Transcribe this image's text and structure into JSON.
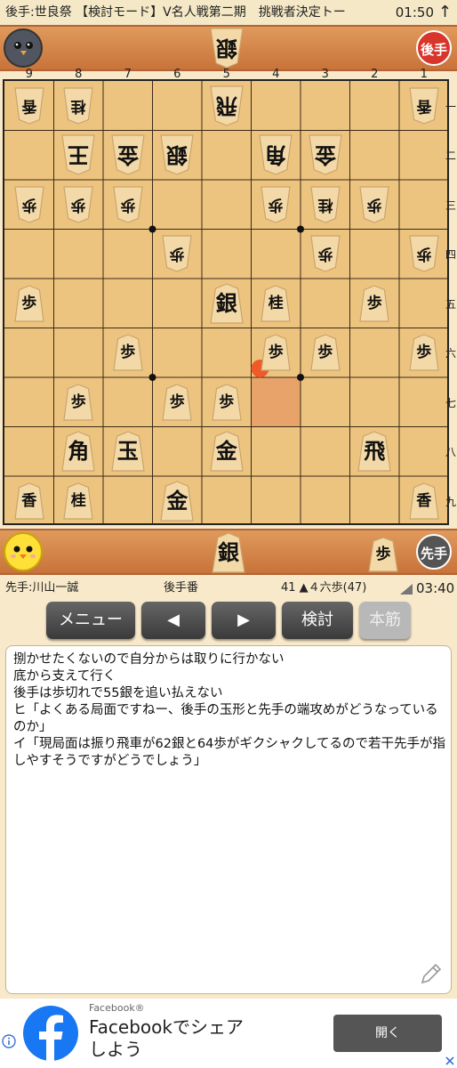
{
  "status_bar": {
    "title": "後手:世良祭 【検討モード】V名人戦第二期　挑戦者決定トー",
    "time": "01:50",
    "up_arrow": "↑"
  },
  "gote_bar": {
    "avatar_icon": "gray-bird-icon",
    "hand_pieces": [
      "銀"
    ],
    "badge": "後手",
    "badge_color": "#d9362b"
  },
  "sente_bar": {
    "avatar_icon": "yellow-chick-icon",
    "hand_pieces": [
      "銀",
      "歩"
    ],
    "badge": "先手",
    "badge_color": "#555555"
  },
  "board": {
    "files": [
      "9",
      "8",
      "7",
      "6",
      "5",
      "4",
      "3",
      "2",
      "1"
    ],
    "ranks": [
      "一",
      "二",
      "三",
      "四",
      "五",
      "六",
      "七",
      "八",
      "九"
    ],
    "pieces": [
      {
        "f": 9,
        "r": 1,
        "p": "香",
        "side": "gote"
      },
      {
        "f": 8,
        "r": 1,
        "p": "桂",
        "side": "gote"
      },
      {
        "f": 5,
        "r": 1,
        "p": "飛",
        "side": "gote"
      },
      {
        "f": 1,
        "r": 1,
        "p": "香",
        "side": "gote"
      },
      {
        "f": 8,
        "r": 2,
        "p": "王",
        "side": "gote"
      },
      {
        "f": 7,
        "r": 2,
        "p": "金",
        "side": "gote"
      },
      {
        "f": 6,
        "r": 2,
        "p": "銀",
        "side": "gote"
      },
      {
        "f": 4,
        "r": 2,
        "p": "角",
        "side": "gote"
      },
      {
        "f": 3,
        "r": 2,
        "p": "金",
        "side": "gote"
      },
      {
        "f": 9,
        "r": 3,
        "p": "歩",
        "side": "gote"
      },
      {
        "f": 8,
        "r": 3,
        "p": "歩",
        "side": "gote"
      },
      {
        "f": 7,
        "r": 3,
        "p": "歩",
        "side": "gote"
      },
      {
        "f": 4,
        "r": 3,
        "p": "歩",
        "side": "gote"
      },
      {
        "f": 3,
        "r": 3,
        "p": "桂",
        "side": "gote"
      },
      {
        "f": 2,
        "r": 3,
        "p": "歩",
        "side": "gote"
      },
      {
        "f": 6,
        "r": 4,
        "p": "歩",
        "side": "gote"
      },
      {
        "f": 3,
        "r": 4,
        "p": "歩",
        "side": "gote"
      },
      {
        "f": 1,
        "r": 4,
        "p": "歩",
        "side": "gote"
      },
      {
        "f": 9,
        "r": 5,
        "p": "歩",
        "side": "sente"
      },
      {
        "f": 5,
        "r": 5,
        "p": "銀",
        "side": "sente"
      },
      {
        "f": 4,
        "r": 5,
        "p": "桂",
        "side": "sente"
      },
      {
        "f": 2,
        "r": 5,
        "p": "歩",
        "side": "sente"
      },
      {
        "f": 7,
        "r": 6,
        "p": "歩",
        "side": "sente"
      },
      {
        "f": 4,
        "r": 6,
        "p": "歩",
        "side": "sente"
      },
      {
        "f": 3,
        "r": 6,
        "p": "歩",
        "side": "sente"
      },
      {
        "f": 1,
        "r": 6,
        "p": "歩",
        "side": "sente"
      },
      {
        "f": 8,
        "r": 7,
        "p": "歩",
        "side": "sente"
      },
      {
        "f": 6,
        "r": 7,
        "p": "歩",
        "side": "sente"
      },
      {
        "f": 5,
        "r": 7,
        "p": "歩",
        "side": "sente"
      },
      {
        "f": 8,
        "r": 8,
        "p": "角",
        "side": "sente"
      },
      {
        "f": 7,
        "r": 8,
        "p": "玉",
        "side": "sente"
      },
      {
        "f": 5,
        "r": 8,
        "p": "金",
        "side": "sente"
      },
      {
        "f": 2,
        "r": 8,
        "p": "飛",
        "side": "sente"
      },
      {
        "f": 9,
        "r": 9,
        "p": "香",
        "side": "sente"
      },
      {
        "f": 8,
        "r": 9,
        "p": "桂",
        "side": "sente"
      },
      {
        "f": 6,
        "r": 9,
        "p": "金",
        "side": "sente"
      },
      {
        "f": 1,
        "r": 9,
        "p": "香",
        "side": "sente"
      }
    ],
    "last_move_from": {
      "f": 4,
      "r": 7
    },
    "last_move_color": "#e8a36a",
    "move_marker_color": "#f05a28"
  },
  "info": {
    "sente_player": "先手:川山一誠",
    "turn": "後手番",
    "move": "41 ▲４六歩(47)",
    "remaining_time": "03:40"
  },
  "buttons": {
    "menu": "メニュー",
    "prev": "◀",
    "next": "▶",
    "analyze": "検討",
    "mainline": "本筋"
  },
  "comment": {
    "text": "捌かせたくないので自分からは取りに行かない\n底から支えて行く\n後手は歩切れで55銀を追い払えない\nヒ「よくある局面ですねー、後手の玉形と先手の端攻めがどうなっているのか」\nイ「現局面は振り飛車が62銀と64歩がギクシャクしてるので若干先手が指しやすそうですがどうでしょう」",
    "edit_icon": "pencil-icon"
  },
  "ad": {
    "icon": "facebook-icon",
    "advertiser": "Facebook®",
    "headline": "Facebookでシェア\nしよう",
    "cta": "開く",
    "info_icon": "info-icon",
    "close_icon": "close-icon"
  }
}
